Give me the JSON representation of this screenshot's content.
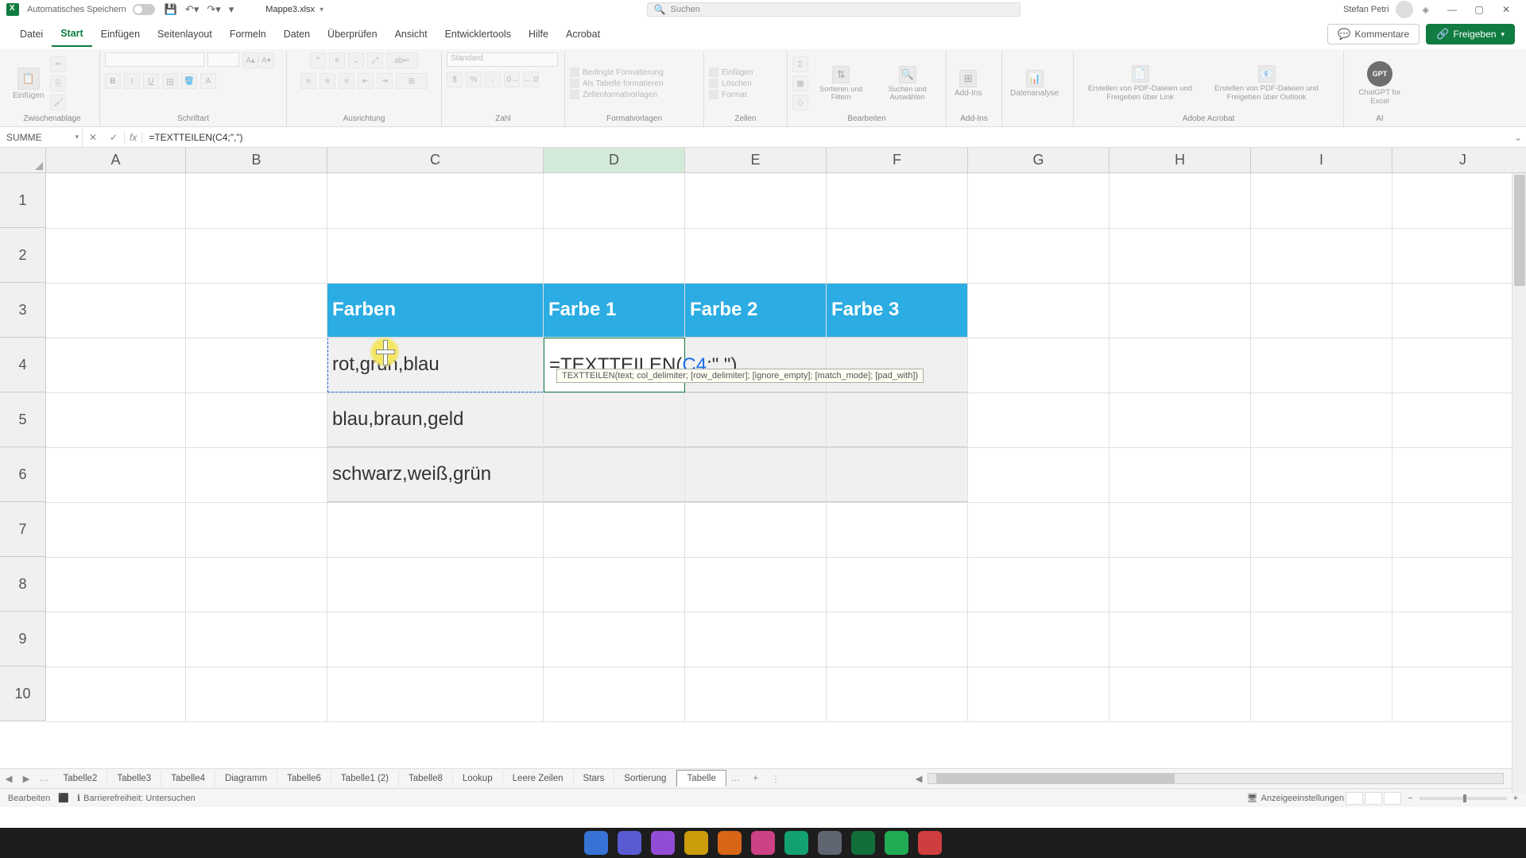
{
  "title": {
    "autosave": "Automatisches Speichern",
    "filename": "Mappe3.xlsx",
    "search_placeholder": "Suchen",
    "user": "Stefan Petri"
  },
  "tabs": {
    "items": [
      "Datei",
      "Start",
      "Einfügen",
      "Seitenlayout",
      "Formeln",
      "Daten",
      "Überprüfen",
      "Ansicht",
      "Entwicklertools",
      "Hilfe",
      "Acrobat"
    ],
    "active": 1,
    "comments": "Kommentare",
    "share": "Freigeben"
  },
  "ribbon": {
    "paste": "Einfügen",
    "clipboard": "Zwischenablage",
    "font": "Schriftart",
    "align": "Ausrichtung",
    "number": "Zahl",
    "number_fmt": "Standard",
    "styles": "Formatvorlagen",
    "cond": "Bedingte Formatierung",
    "astable": "Als Tabelle formatieren",
    "cellstyles": "Zellenformatvorlagen",
    "cells": "Zellen",
    "ins": "Einfügen",
    "del": "Löschen",
    "fmt": "Format",
    "edit": "Bearbeiten",
    "sort": "Sortieren und Filtern",
    "find": "Suchen und Auswählen",
    "addins": "Add-Ins",
    "addins_btn": "Add-Ins",
    "analyse": "Datenanalyse",
    "pdf1": "Erstellen von PDF-Dateien und Freigeben über Link",
    "pdf2": "Erstellen von PDF-Dateien und Freigeben über Outlook",
    "acro": "Adobe Acrobat",
    "gpt": "ChatGPT for Excel",
    "ai": "AI"
  },
  "fbar": {
    "name": "SUMME",
    "formula": "=TEXTTEILEN(C4;\",\")"
  },
  "cols": [
    "A",
    "B",
    "C",
    "D",
    "E",
    "F",
    "G",
    "H",
    "I",
    "J"
  ],
  "rows": [
    "1",
    "2",
    "3",
    "4",
    "5",
    "6",
    "7",
    "8",
    "9",
    "10"
  ],
  "thead": [
    "Farben",
    "Farbe 1",
    "Farbe 2",
    "Farbe 3"
  ],
  "tdata": {
    "c4": "rot,grün,blau",
    "c5": "blau,braun,geld",
    "c6": "schwarz,weiß,grün",
    "d4_prefix": "=TEXTTEILEN(",
    "d4_ref": "C4",
    "d4_suffix": ";\",\")"
  },
  "tooltip": "TEXTTEILEN(text; col_delimiter; [row_delimiter]; [ignore_empty]; [match_mode]; [pad_with])",
  "sheets": {
    "items": [
      "Tabelle2",
      "Tabelle3",
      "Tabelle4",
      "Diagramm",
      "Tabelle6",
      "Tabelle1 (2)",
      "Tabelle8",
      "Lookup",
      "Leere Zeilen",
      "Stars",
      "Sortierung",
      "Tabelle"
    ],
    "active": 11
  },
  "status": {
    "mode": "Bearbeiten",
    "access": "Barrierefreiheit: Untersuchen",
    "display": "Anzeigeeinstellungen"
  }
}
